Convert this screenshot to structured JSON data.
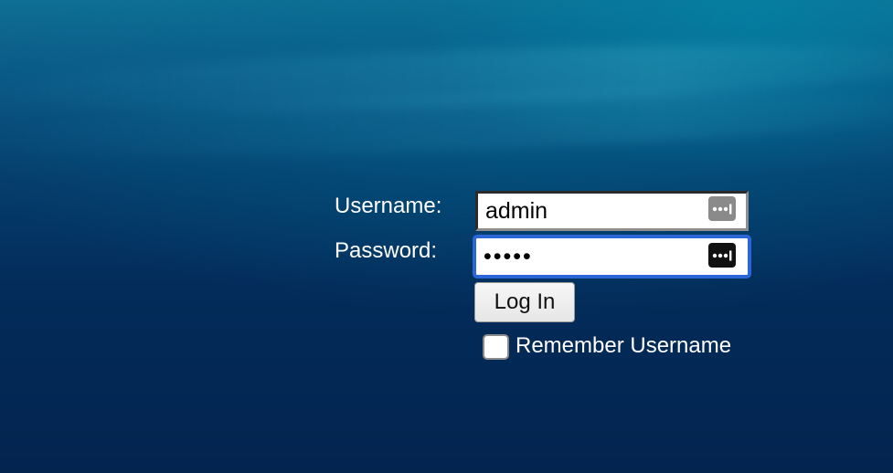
{
  "login_form": {
    "username_label": "Username:",
    "username_value": "admin",
    "password_label": "Password:",
    "password_value": "•••••",
    "login_button_label": "Log In",
    "remember_label": "Remember Username",
    "remember_checked": false
  },
  "icons": {
    "username_field_icon": "password-key-icon",
    "password_field_icon": "password-key-icon"
  },
  "colors": {
    "focus_ring": "#2a66d8",
    "background_top": "#0f6f94",
    "background_bottom": "#03244f"
  }
}
